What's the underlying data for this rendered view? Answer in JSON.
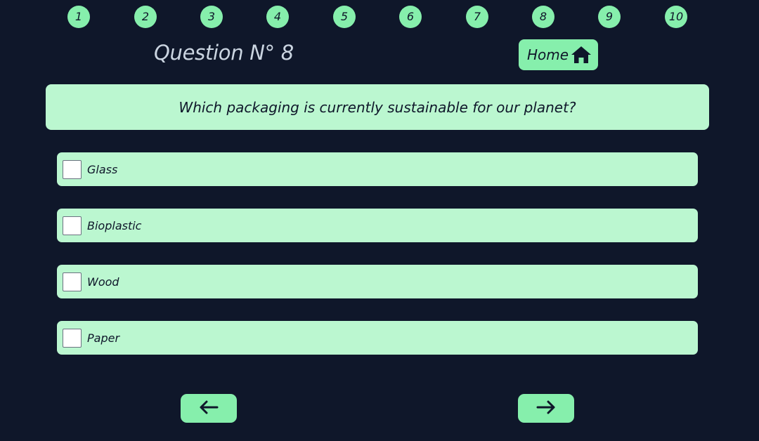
{
  "question_nav": [
    "1",
    "2",
    "3",
    "4",
    "5",
    "6",
    "7",
    "8",
    "9",
    "10"
  ],
  "header": {
    "title": "Question N° 8",
    "home_label": "Home",
    "home_icon": "home-icon"
  },
  "question": {
    "text": "Which packaging is currently sustainable for our planet?"
  },
  "options": [
    {
      "label": "Glass",
      "checked": false
    },
    {
      "label": "Bioplastic",
      "checked": false
    },
    {
      "label": "Wood",
      "checked": false
    },
    {
      "label": "Paper",
      "checked": false
    }
  ],
  "navigation": {
    "prev_icon": "arrow-left-icon",
    "next_icon": "arrow-right-icon"
  },
  "colors": {
    "background": "#0f172a",
    "accent": "#86efac",
    "panel": "#bbf7d0",
    "title_text": "#cbd5e1"
  }
}
